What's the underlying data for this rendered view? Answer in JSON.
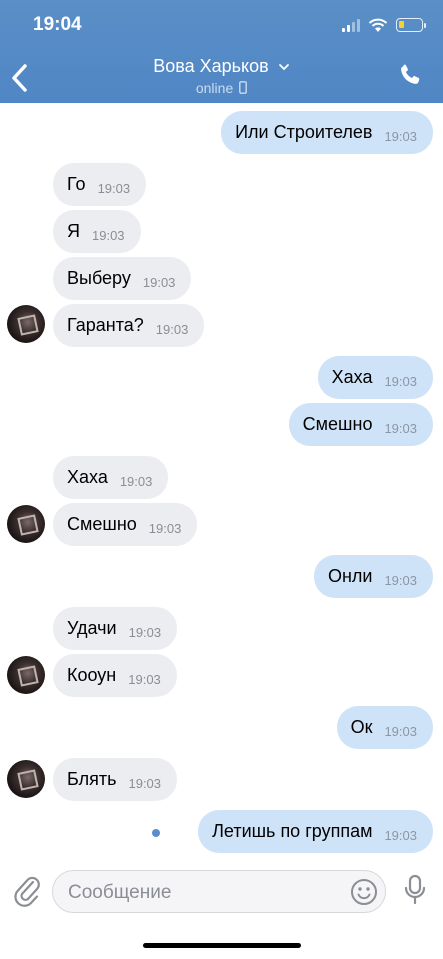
{
  "status_bar": {
    "time": "19:04"
  },
  "header": {
    "contact_name": "Вова Харьков",
    "chevron": "chevron-down-icon",
    "status": "online",
    "status_icon": "mobile-icon"
  },
  "messages": [
    {
      "dir": "out",
      "text": "Или Строителев",
      "time": "19:03"
    },
    {
      "dir": "in",
      "text": "Го",
      "time": "19:03"
    },
    {
      "dir": "in",
      "text": "Я",
      "time": "19:03"
    },
    {
      "dir": "in",
      "text": "Выберу",
      "time": "19:03"
    },
    {
      "dir": "in",
      "text": "Гаранта?",
      "time": "19:03"
    },
    {
      "dir": "out",
      "text": "Хаха",
      "time": "19:03"
    },
    {
      "dir": "out",
      "text": "Смешно",
      "time": "19:03"
    },
    {
      "dir": "in",
      "text": "Хаха",
      "time": "19:03"
    },
    {
      "dir": "in",
      "text": "Смешно",
      "time": "19:03"
    },
    {
      "dir": "out",
      "text": "Онли",
      "time": "19:03"
    },
    {
      "dir": "in",
      "text": "Удачи",
      "time": "19:03"
    },
    {
      "dir": "in",
      "text": "Кооун",
      "time": "19:03"
    },
    {
      "dir": "out",
      "text": "Ок",
      "time": "19:03"
    },
    {
      "dir": "in",
      "text": "Блять",
      "time": "19:03"
    },
    {
      "dir": "out",
      "text": "Летишь по группам",
      "time": "19:03"
    }
  ],
  "composer": {
    "placeholder": "Сообщение"
  },
  "colors": {
    "header": "#5088c5",
    "incoming_bubble": "#ecedf0",
    "outgoing_bubble": "#cfe3f8",
    "unread_dot": "#5b8dcc"
  }
}
